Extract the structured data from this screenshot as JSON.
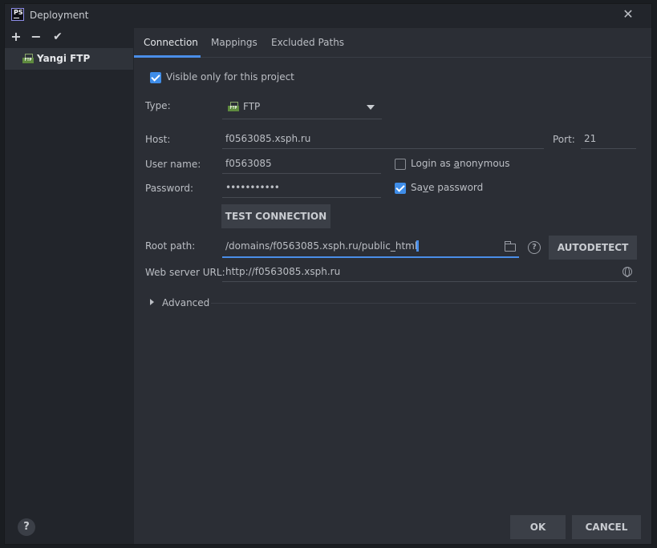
{
  "window": {
    "title": "Deployment",
    "app_logo": "PS"
  },
  "sidebar": {
    "tools": {
      "add": "+",
      "remove": "−",
      "apply": "✔"
    },
    "items": [
      {
        "label": "Yangi FTP",
        "icon": "ftp-icon"
      }
    ]
  },
  "tabs": [
    {
      "label": "Connection"
    },
    {
      "label": "Mappings"
    },
    {
      "label": "Excluded Paths"
    }
  ],
  "form": {
    "visible_only_label": "Visible only for this project",
    "visible_only_checked": true,
    "type_label": "Type:",
    "type_value": "FTP",
    "host_label": "Host:",
    "host_value": "f0563085.xsph.ru",
    "port_label": "Port:",
    "port_value": "21",
    "username_label": "User name:",
    "username_value": "f0563085",
    "login_anon_pre": "Login as ",
    "login_anon_u": "a",
    "login_anon_post": "nonymous",
    "login_anon_checked": false,
    "password_label": "Password:",
    "password_value": "•••••••••••",
    "save_pw_pre": "Sa",
    "save_pw_u": "v",
    "save_pw_post": "e password",
    "save_pw_checked": true,
    "test_connection": "TEST CONNECTION",
    "root_path_label": "Root path:",
    "root_path_value": "/domains/f0563085.xsph.ru/public_html",
    "autodetect": "AUTODETECT",
    "web_url_label": "Web server URL:",
    "web_url_value": "http://f0563085.xsph.ru",
    "advanced_label": "Advanced"
  },
  "footer": {
    "help": "?",
    "ok": "OK",
    "cancel": "CANCEL"
  },
  "colors": {
    "accent": "#4a8ee8",
    "background": "#2b2e35",
    "sidebar": "#22252b",
    "ftp_green": "#5e8a3e"
  }
}
